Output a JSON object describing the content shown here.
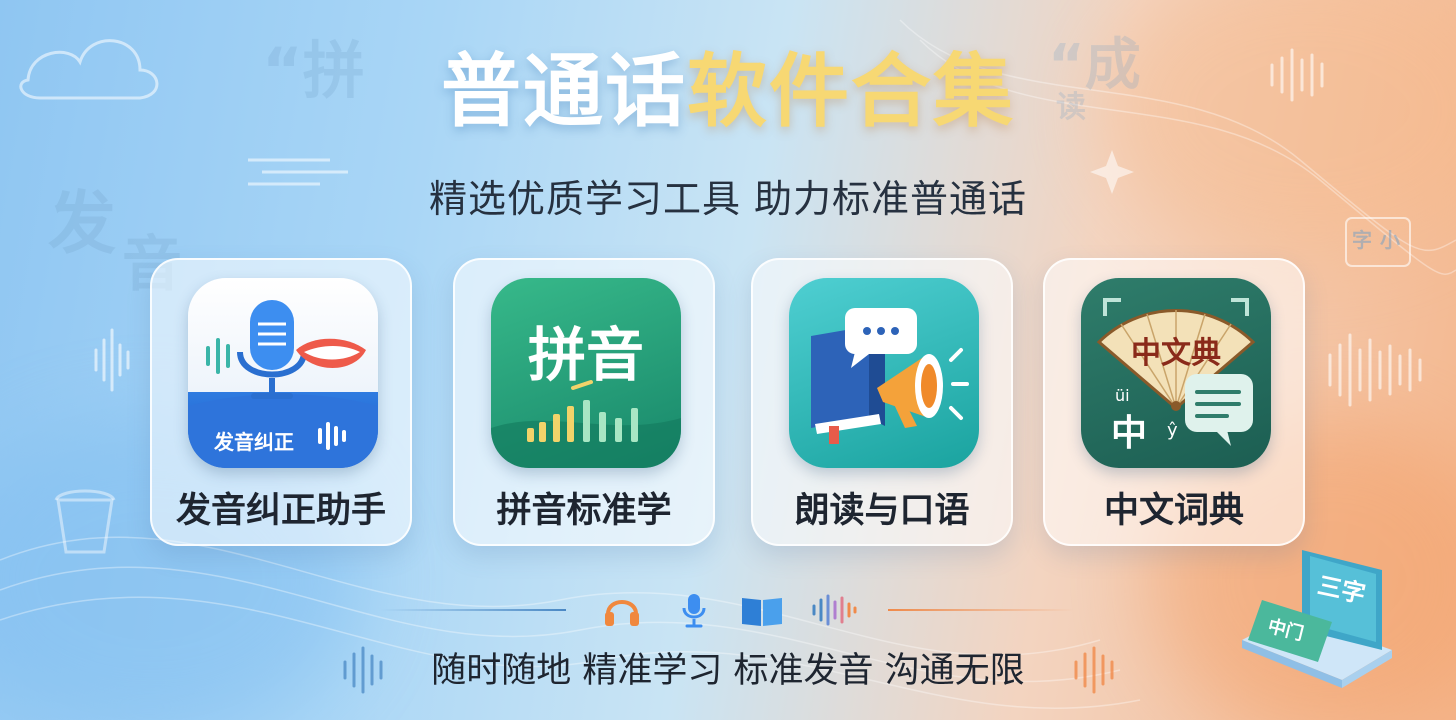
{
  "title": {
    "part1": "普通话",
    "part2": "软件合集"
  },
  "subtitle": "精选优质学习工具 助力标准普通话",
  "apps": [
    {
      "label": "发音纠正助手",
      "icon": "microphone-lips-icon",
      "badge": "发音纠正"
    },
    {
      "label": "拼音标准学",
      "icon": "pinyin-icon",
      "badge": "拼音"
    },
    {
      "label": "朗读与口语",
      "icon": "book-megaphone-icon"
    },
    {
      "label": "中文词典",
      "icon": "fan-dictionary-icon",
      "fan_text": "中文典",
      "char": "中",
      "pinyin_top": "üi",
      "pinyin_bottom": "ŷ"
    }
  ],
  "feature_icons": [
    "headphones-icon",
    "microphone-icon",
    "open-book-icon",
    "sound-wave-icon"
  ],
  "footer": "随时随地 精准学习 标准发音 沟通无限",
  "decor": {
    "ghost_chars": [
      "“拼",
      "“成",
      "读",
      "发",
      "音",
      "小",
      "字"
    ],
    "book_chars": [
      "三字",
      "中门"
    ]
  },
  "colors": {
    "title_white": "#ffffff",
    "title_gold": "#f7d873",
    "text_dark": "#1e2530"
  }
}
